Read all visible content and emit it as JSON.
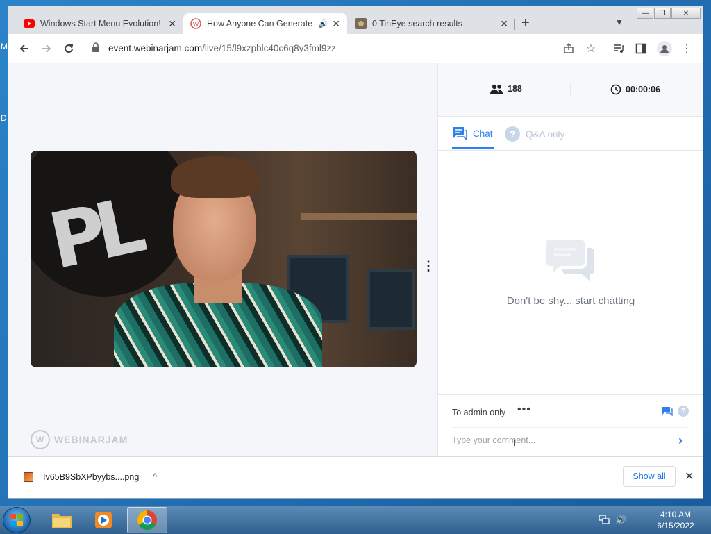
{
  "desktop": {
    "letters": [
      "M",
      "D"
    ]
  },
  "browser": {
    "tabs": [
      {
        "title": "Windows Start Menu Evolution! |",
        "icon": "youtube-icon",
        "active": false
      },
      {
        "title": "How Anyone Can Generate $",
        "icon": "webinarjam-icon",
        "active": true
      },
      {
        "title": "0 TinEye search results",
        "icon": "tineye-icon",
        "active": false
      }
    ],
    "new_tab_label": "+",
    "window_controls": {
      "minimize": "—",
      "restore": "❐",
      "close": "✕"
    },
    "address": {
      "domain": "event.webinarjam.com",
      "path": "/live/15/l9xzpblc40c6q8y3fml9zz"
    }
  },
  "page": {
    "brand_watermark": "WEBINARJAM",
    "chat_panel": {
      "attendees": "188",
      "elapsed": "00:00:06",
      "tabs": [
        {
          "label": "Chat",
          "active": true
        },
        {
          "label": "Q&A only",
          "active": false
        }
      ],
      "empty_message": "Don't be shy... start chatting",
      "recipient": "To admin only",
      "more": "•••",
      "comment_placeholder": "Type your comment...",
      "accent_color": "#2f80ed"
    }
  },
  "download_bar": {
    "file_name": "Iv65B9SbXPbyybs....png",
    "show_all": "Show all"
  },
  "taskbar": {
    "apps": [
      "explorer-icon",
      "media-player-icon",
      "chrome-icon"
    ],
    "time": "4:10 AM",
    "date": "6/15/2022"
  }
}
